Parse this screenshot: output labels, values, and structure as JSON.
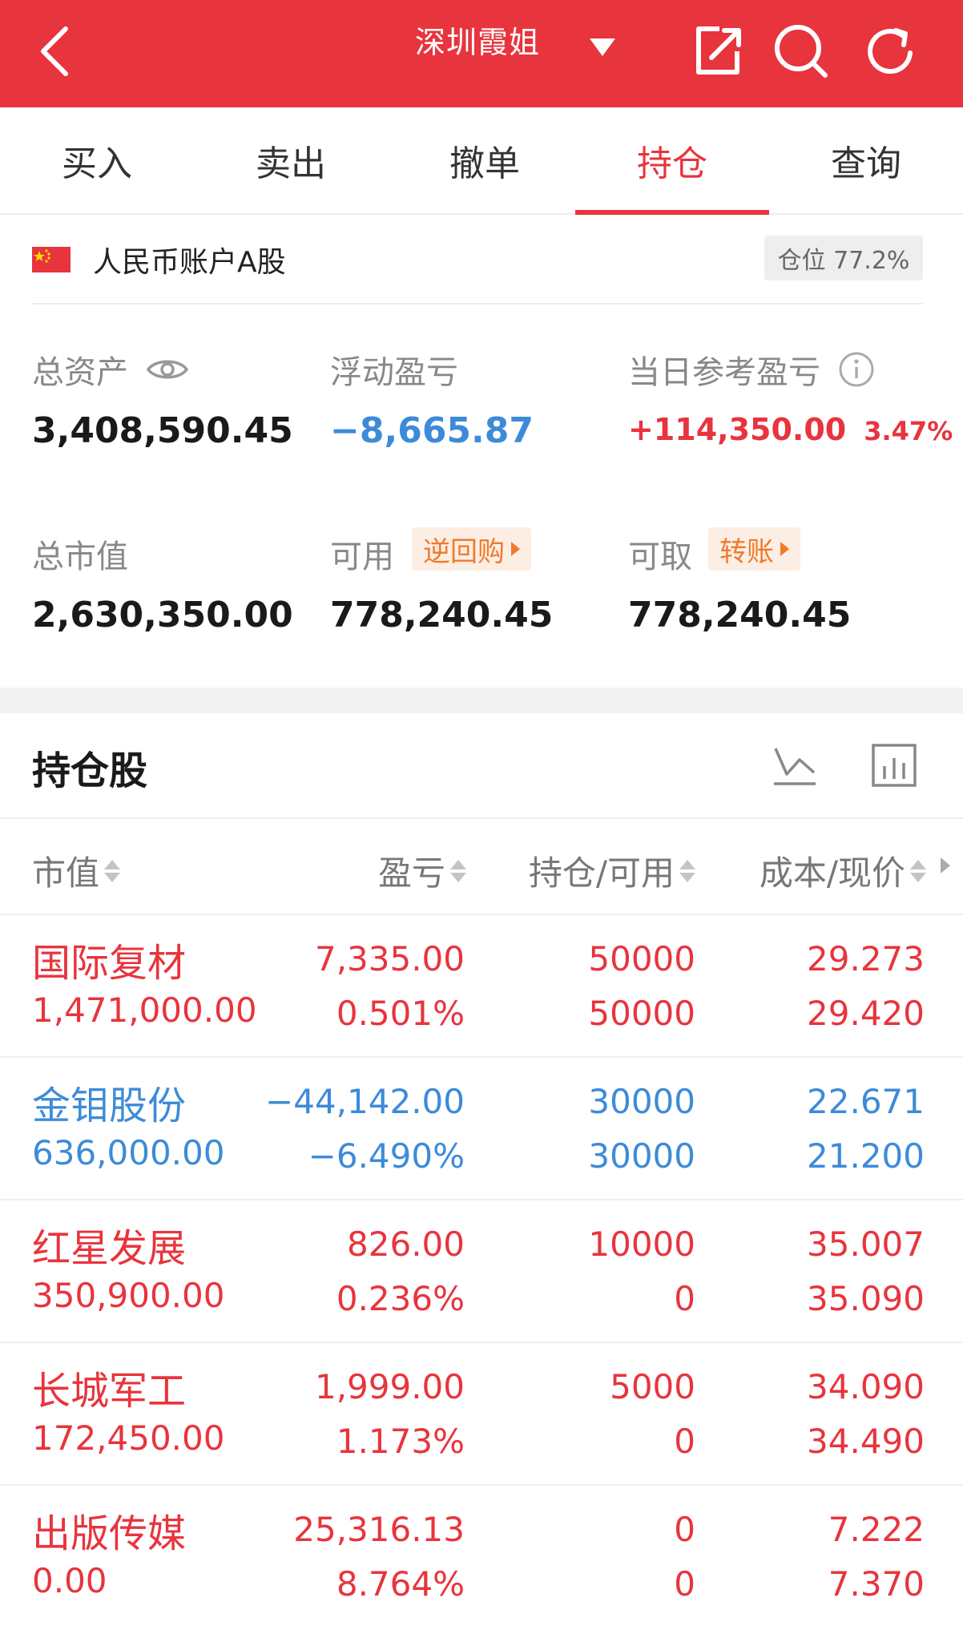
{
  "header": {
    "title": "深圳霞姐",
    "icons": [
      "back-icon",
      "dropdown-caret-icon",
      "share-icon",
      "search-icon",
      "refresh-icon"
    ]
  },
  "tabs": [
    {
      "label": "买入",
      "active": false
    },
    {
      "label": "卖出",
      "active": false
    },
    {
      "label": "撤单",
      "active": false
    },
    {
      "label": "持仓",
      "active": true
    },
    {
      "label": "查询",
      "active": false
    }
  ],
  "account": {
    "name": "人民币账户A股",
    "position_label": "仓位 77.2%"
  },
  "summary": {
    "total_assets_label": "总资产",
    "total_assets": "3,408,590.45",
    "floating_pl_label": "浮动盈亏",
    "floating_pl": "−8,665.87",
    "daily_pl_label": "当日参考盈亏",
    "daily_pl": "+114,350.00",
    "daily_pl_pct": "3.47%",
    "market_value_label": "总市值",
    "market_value": "2,630,350.00",
    "available_label": "可用",
    "available": "778,240.45",
    "reverse_repo_label": "逆回购",
    "withdrawable_label": "可取",
    "withdrawable": "778,240.45",
    "transfer_label": "转账"
  },
  "holdings": {
    "title": "持仓股",
    "columns": [
      "市值",
      "盈亏",
      "持仓/可用",
      "成本/现价"
    ],
    "rows": [
      {
        "name": "国际复材",
        "market_value": "1,471,000.00",
        "pl": "7,335.00",
        "pl_pct": "0.501%",
        "position": "50000",
        "available": "50000",
        "cost": "29.273",
        "price": "29.420",
        "color": "#e8343d"
      },
      {
        "name": "金钼股份",
        "market_value": "636,000.00",
        "pl": "−44,142.00",
        "pl_pct": "−6.490%",
        "position": "30000",
        "available": "30000",
        "cost": "22.671",
        "price": "21.200",
        "color": "#3d8bd8"
      },
      {
        "name": "红星发展",
        "market_value": "350,900.00",
        "pl": "826.00",
        "pl_pct": "0.236%",
        "position": "10000",
        "available": "0",
        "cost": "35.007",
        "price": "35.090",
        "color": "#e8343d"
      },
      {
        "name": "长城军工",
        "market_value": "172,450.00",
        "pl": "1,999.00",
        "pl_pct": "1.173%",
        "position": "5000",
        "available": "0",
        "cost": "34.090",
        "price": "34.490",
        "color": "#e8343d"
      },
      {
        "name": "出版传媒",
        "market_value": "0.00",
        "pl": "25,316.13",
        "pl_pct": "8.764%",
        "position": "0",
        "available": "0",
        "cost": "7.222",
        "price": "7.370",
        "color": "#e8343d"
      }
    ]
  },
  "colors": {
    "brand_red": "#e8343d",
    "loss_blue": "#3d8bd8",
    "accent_orange": "#f07a2d"
  }
}
